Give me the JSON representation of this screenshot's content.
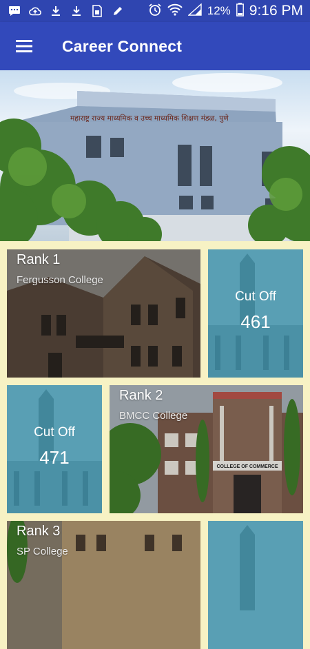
{
  "status_bar": {
    "battery": "12%",
    "time": "9:16 PM",
    "left_icons": [
      "message-icon",
      "cloud-upload-icon",
      "download-icon",
      "download-icon",
      "sim-card-icon",
      "pen-icon"
    ],
    "right_icons": [
      "alarm-icon",
      "wifi-icon",
      "signal-icon",
      "battery-icon"
    ]
  },
  "app_bar": {
    "title": "Career Connect",
    "menu_icon": "hamburger-menu-icon"
  },
  "hero": {
    "building_sign": "महाराष्ट्र राज्य माध्यमिक व उच्च माध्यमिक शिक्षण मंडळ, पुणे"
  },
  "colleges": [
    {
      "rank": "Rank 1",
      "name": "Fergusson College",
      "cut_off_label": "Cut Off",
      "cut_off": "461"
    },
    {
      "rank": "Rank 2",
      "name": "BMCC College",
      "cut_off_label": "Cut Off",
      "cut_off": "471"
    },
    {
      "rank": "Rank 3",
      "name": "SP College",
      "cut_off_label": "",
      "cut_off": ""
    }
  ],
  "bmcc_sign": "COLLEGE OF COMMERCE",
  "colors": {
    "status_bar": "#2f45b0",
    "app_bar": "#3249bb",
    "grid_background": "#f7f2c4",
    "cutoff_overlay": "#3a8ea6"
  }
}
